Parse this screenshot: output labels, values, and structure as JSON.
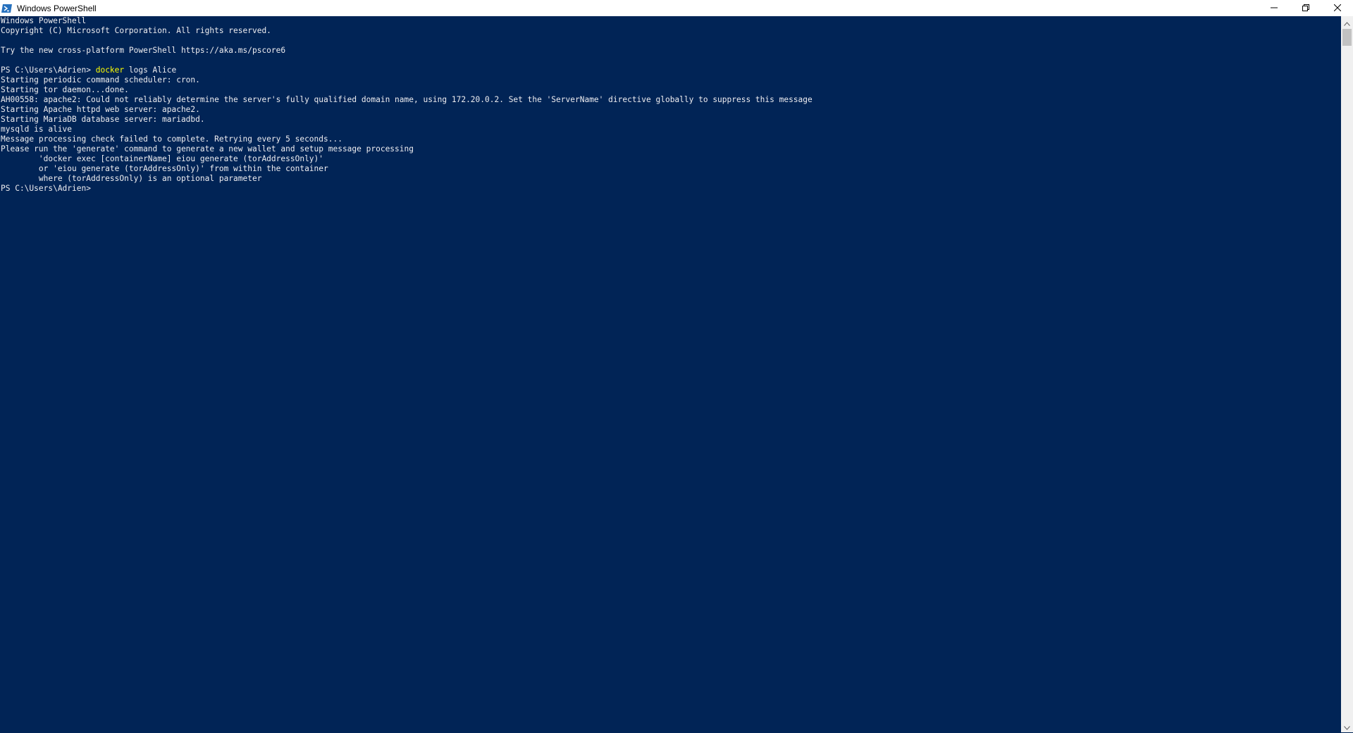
{
  "window": {
    "title": "Windows PowerShell"
  },
  "icons": {
    "app": "powershell-icon",
    "minimize": "minimize-icon",
    "restore": "restore-icon",
    "close": "close-icon"
  },
  "colors": {
    "background": "#012456",
    "text": "#eeedf0",
    "command": "#ffff00"
  },
  "terminal": {
    "lines": [
      "Windows PowerShell",
      "Copyright (C) Microsoft Corporation. All rights reserved.",
      "",
      "Try the new cross-platform PowerShell https://aka.ms/pscore6",
      "",
      "",
      "Starting periodic command scheduler: cron.",
      "Starting tor daemon...done.",
      "AH00558: apache2: Could not reliably determine the server's fully qualified domain name, using 172.20.0.2. Set the 'ServerName' directive globally to suppress this message",
      "Starting Apache httpd web server: apache2.",
      "Starting MariaDB database server: mariadbd.",
      "mysqld is alive",
      "Message processing check failed to complete. Retrying every 5 seconds...",
      "Please run the 'generate' command to generate a new wallet and setup message processing",
      "        'docker exec [containerName] eiou generate (torAddressOnly)'",
      "        or 'eiou generate (torAddressOnly)' from within the container",
      "        where (torAddressOnly) is an optional parameter",
      "PS C:\\Users\\Adrien>"
    ],
    "command_line": {
      "prompt": "PS C:\\Users\\Adrien> ",
      "command": "docker",
      "args": " logs Alice"
    }
  }
}
